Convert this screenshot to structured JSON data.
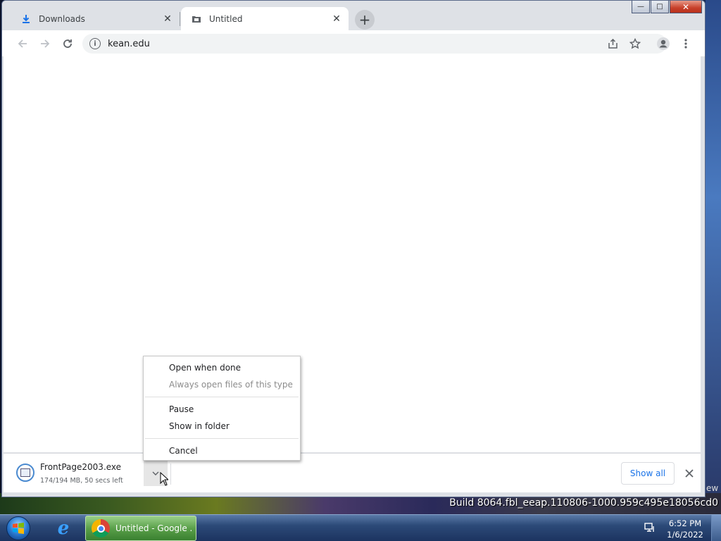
{
  "browser": {
    "tabs": [
      {
        "title": "Downloads",
        "icon": "download-icon",
        "active": false
      },
      {
        "title": "Untitled",
        "icon": "page-icon",
        "active": true
      }
    ],
    "new_tab_label": "+",
    "address": {
      "url": "kean.edu"
    },
    "window_controls": {
      "minimize": "—",
      "maximize": "□",
      "close": "✕"
    }
  },
  "context_menu": {
    "items": [
      {
        "label": "Open when done",
        "enabled": true
      },
      {
        "label": "Always open files of this type",
        "enabled": false
      },
      {
        "label": "Pause",
        "enabled": true
      },
      {
        "label": "Show in folder",
        "enabled": true
      },
      {
        "label": "Cancel",
        "enabled": true
      }
    ]
  },
  "download_shelf": {
    "file_name": "FrontPage2003.exe",
    "status": "174/194 MB, 50 secs left",
    "show_all_label": "Show all"
  },
  "desktop": {
    "build_text": "Build 8064.fbl_eeap.110806-1000.959c495e18056cd0",
    "edge_text": "ew"
  },
  "taskbar": {
    "chrome_task_label": "Untitled - Google ...",
    "clock_time": "6:52 PM",
    "clock_date": "1/6/2022"
  },
  "colors": {
    "accent": "#1a73e8",
    "tab_strip": "#dee1e6",
    "omnibox": "#f1f3f4"
  }
}
